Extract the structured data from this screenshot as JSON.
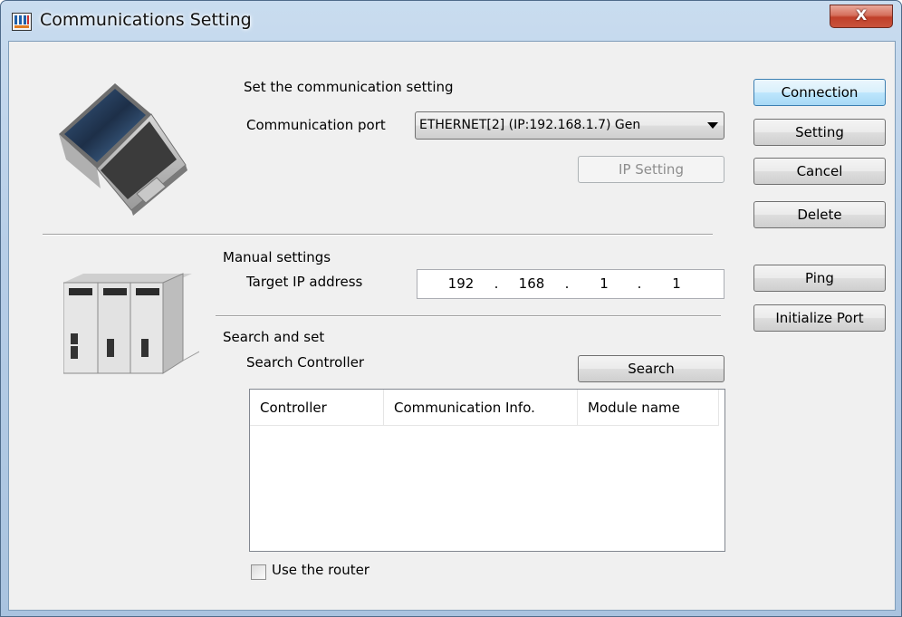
{
  "window": {
    "title": "Communications Setting",
    "close_label": "X"
  },
  "connection_section": {
    "heading": "Set the communication setting",
    "port_label": "Communication port",
    "port_value": "ETHERNET[2]  (IP:192.168.1.7) Gen",
    "ip_setting_label": "IP Setting"
  },
  "manual_section": {
    "heading": "Manual settings",
    "target_ip_label": "Target IP address",
    "ip_octets": [
      "192",
      "168",
      "1",
      "1"
    ],
    "ip_dot": "."
  },
  "search_section": {
    "heading": "Search and set",
    "search_controller_label": "Search Controller",
    "search_button": "Search",
    "columns": [
      "Controller",
      "Communication Info.",
      "Module name"
    ],
    "use_router_label": "Use the router",
    "use_router_checked": false
  },
  "side_buttons": {
    "connection": "Connection",
    "setting": "Setting",
    "cancel": "Cancel",
    "delete": "Delete",
    "ping": "Ping",
    "initialize_port": "Initialize Port"
  },
  "icons": {
    "app": "communications-app-icon",
    "laptop": "laptop-icon",
    "controller": "plc-controller-icon"
  },
  "colors": {
    "default_button_border": "#3c7fb1",
    "close_button": "#c0402a",
    "title_bar": "#b7cee7"
  }
}
